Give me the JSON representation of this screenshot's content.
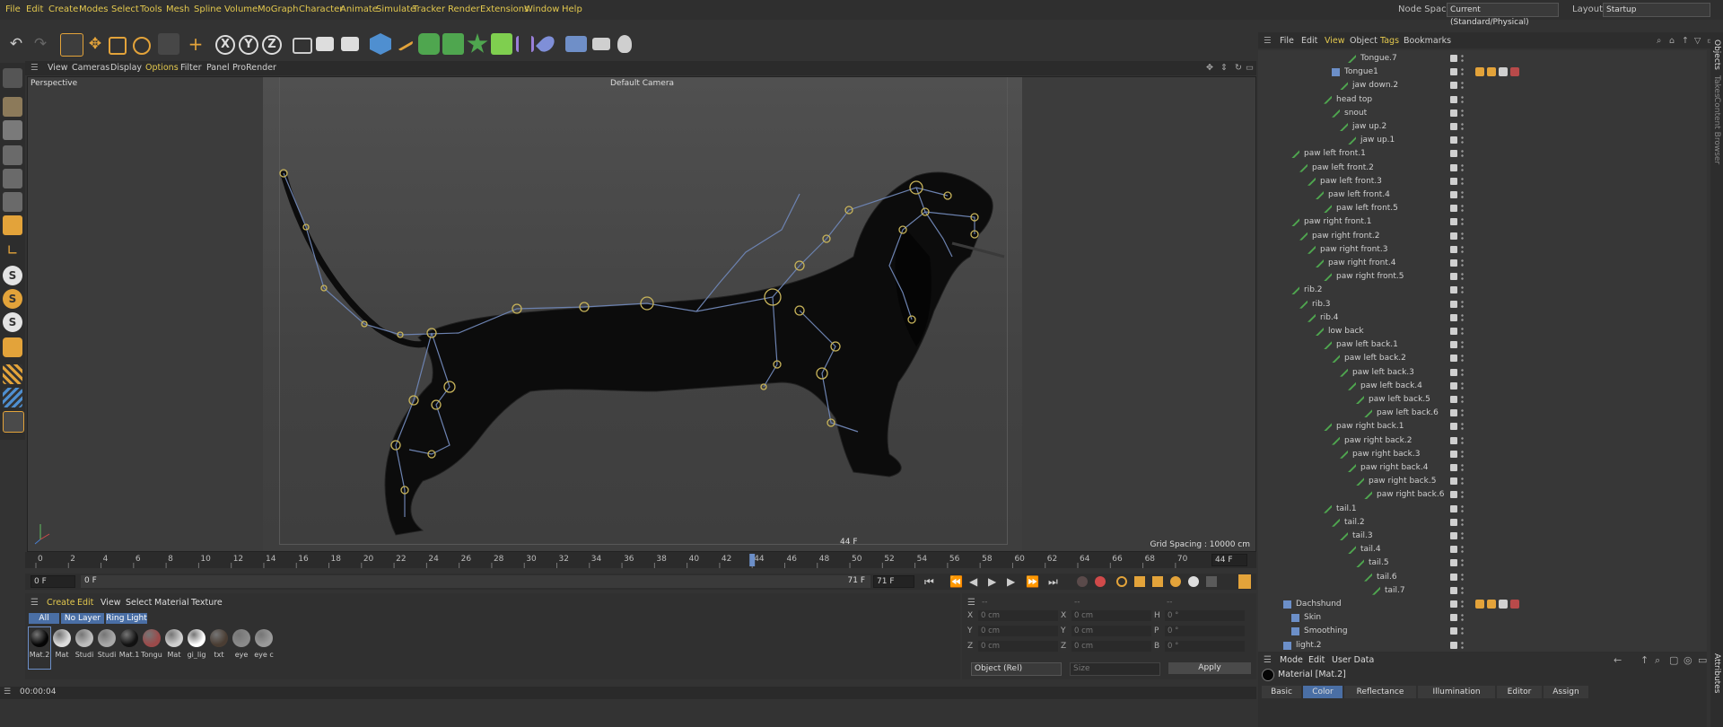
{
  "menubar": {
    "items": [
      "File",
      "Edit",
      "Create",
      "Modes",
      "Select",
      "Tools",
      "Mesh",
      "Spline",
      "Volume",
      "MoGraph",
      "Character",
      "Animate",
      "Simulate",
      "Tracker",
      "Render",
      "Extensions",
      "Window",
      "Help"
    ],
    "node_space_label": "Node Space:",
    "node_space_value": "Current (Standard/Physical)",
    "layout_label": "Layout:",
    "layout_value": "Startup"
  },
  "toolbar": {
    "axis_x": "X",
    "axis_y": "Y",
    "axis_z": "Z"
  },
  "viewport": {
    "menu": [
      "View",
      "Cameras",
      "Display",
      "Options",
      "Filter",
      "Panel",
      "ProRender"
    ],
    "projection": "Perspective",
    "camera": "Default Camera",
    "current_frame": "44 F",
    "grid_spacing": "Grid Spacing : 10000 cm"
  },
  "timeline": {
    "ticks": [
      "0",
      "2",
      "4",
      "6",
      "8",
      "10",
      "12",
      "14",
      "16",
      "18",
      "20",
      "22",
      "24",
      "26",
      "28",
      "30",
      "32",
      "34",
      "36",
      "38",
      "40",
      "42",
      "44",
      "46",
      "48",
      "50",
      "52",
      "54",
      "56",
      "58",
      "60",
      "62",
      "64",
      "66",
      "68",
      "70"
    ],
    "playhead_frame": 44,
    "max_frame": 71,
    "frame_right": "44 F",
    "start_field": "0 F",
    "min_field": "0 F",
    "end_field": "71 F",
    "max_field": "71 F"
  },
  "material_manager": {
    "menu": [
      "Create",
      "Edit",
      "View",
      "Select",
      "Material",
      "Texture"
    ],
    "filters": [
      "All",
      "No Layer",
      "Ring Light"
    ],
    "materials": [
      {
        "label": "Mat.2",
        "color": "#050505"
      },
      {
        "label": "Mat",
        "color": "#dcdcdc"
      },
      {
        "label": "Studi",
        "color": "#bdbdbd"
      },
      {
        "label": "Studi",
        "color": "#a8a8a8"
      },
      {
        "label": "Mat.1",
        "color": "#111111"
      },
      {
        "label": "Tongu",
        "color": "#9b4a4a"
      },
      {
        "label": "Mat",
        "color": "#cfcfcf"
      },
      {
        "label": "gi_lig",
        "color": "#ffffff"
      },
      {
        "label": "txt",
        "color": "#4a3d33"
      },
      {
        "label": "eye",
        "color": "#8a8a8a"
      },
      {
        "label": "eye c",
        "color": "#9a9a9a"
      }
    ]
  },
  "coordinates": {
    "header_dashes": [
      "--",
      "--",
      "--"
    ],
    "rows": [
      {
        "a": "X",
        "av": "0 cm",
        "b": "X",
        "bv": "0 cm",
        "c": "H",
        "cv": "0 °"
      },
      {
        "a": "Y",
        "av": "0 cm",
        "b": "Y",
        "bv": "0 cm",
        "c": "P",
        "cv": "0 °"
      },
      {
        "a": "Z",
        "av": "0 cm",
        "b": "Z",
        "bv": "0 cm",
        "c": "B",
        "cv": "0 °"
      }
    ],
    "mode": "Object (Rel)",
    "size_mode": "Size",
    "apply": "Apply"
  },
  "status": {
    "time": "00:00:04"
  },
  "object_manager": {
    "menu": [
      "File",
      "Edit",
      "View",
      "Object",
      "Tags",
      "Bookmarks"
    ],
    "tree": [
      {
        "label": "Tongue.7",
        "depth": 8
      },
      {
        "label": "Tongue1",
        "depth": 6
      },
      {
        "label": "jaw down.2",
        "depth": 7
      },
      {
        "label": "head top",
        "depth": 5
      },
      {
        "label": "snout",
        "depth": 6
      },
      {
        "label": "jaw up.2",
        "depth": 7
      },
      {
        "label": "jaw up.1",
        "depth": 8
      },
      {
        "label": "paw left front.1",
        "depth": 1
      },
      {
        "label": "paw left front.2",
        "depth": 2
      },
      {
        "label": "paw left front.3",
        "depth": 3
      },
      {
        "label": "paw left front.4",
        "depth": 4
      },
      {
        "label": "paw left front.5",
        "depth": 5
      },
      {
        "label": "paw right front.1",
        "depth": 1
      },
      {
        "label": "paw right front.2",
        "depth": 2
      },
      {
        "label": "paw right front.3",
        "depth": 3
      },
      {
        "label": "paw right front.4",
        "depth": 4
      },
      {
        "label": "paw right front.5",
        "depth": 5
      },
      {
        "label": "rib.2",
        "depth": 1
      },
      {
        "label": "rib.3",
        "depth": 2
      },
      {
        "label": "rib.4",
        "depth": 3
      },
      {
        "label": "low back",
        "depth": 4
      },
      {
        "label": "paw left back.1",
        "depth": 5
      },
      {
        "label": "paw left back.2",
        "depth": 6
      },
      {
        "label": "paw left back.3",
        "depth": 7
      },
      {
        "label": "paw left back.4",
        "depth": 8
      },
      {
        "label": "paw left back.5",
        "depth": 9
      },
      {
        "label": "paw left back.6",
        "depth": 10
      },
      {
        "label": "paw right back.1",
        "depth": 5
      },
      {
        "label": "paw right back.2",
        "depth": 6
      },
      {
        "label": "paw right back.3",
        "depth": 7
      },
      {
        "label": "paw right back.4",
        "depth": 8
      },
      {
        "label": "paw right back.5",
        "depth": 9
      },
      {
        "label": "paw right back.6",
        "depth": 10
      },
      {
        "label": "tail.1",
        "depth": 5
      },
      {
        "label": "tail.2",
        "depth": 6
      },
      {
        "label": "tail.3",
        "depth": 7
      },
      {
        "label": "tail.4",
        "depth": 8
      },
      {
        "label": "tail.5",
        "depth": 9
      },
      {
        "label": "tail.6",
        "depth": 10
      },
      {
        "label": "tail.7",
        "depth": 11
      },
      {
        "label": "Dachshund",
        "depth": 0
      },
      {
        "label": "Skin",
        "depth": 1
      },
      {
        "label": "Smoothing",
        "depth": 1
      },
      {
        "label": "light.2",
        "depth": 0
      }
    ],
    "side_tabs": [
      "Objects",
      "Takes",
      "Content Browser",
      "Attributes"
    ]
  },
  "attributes": {
    "menu": [
      "Mode",
      "Edit",
      "User Data"
    ],
    "material_title": "Material [Mat.2]",
    "tabs": [
      "Basic",
      "Color",
      "Reflectance",
      "Illumination",
      "Editor",
      "Assign"
    ],
    "active_tab": "Color"
  },
  "colors": {
    "accent": "#e3c84e",
    "joint": "#c8b45a",
    "bone": "#6c82b0",
    "tab_active": "#4a6fa5"
  }
}
